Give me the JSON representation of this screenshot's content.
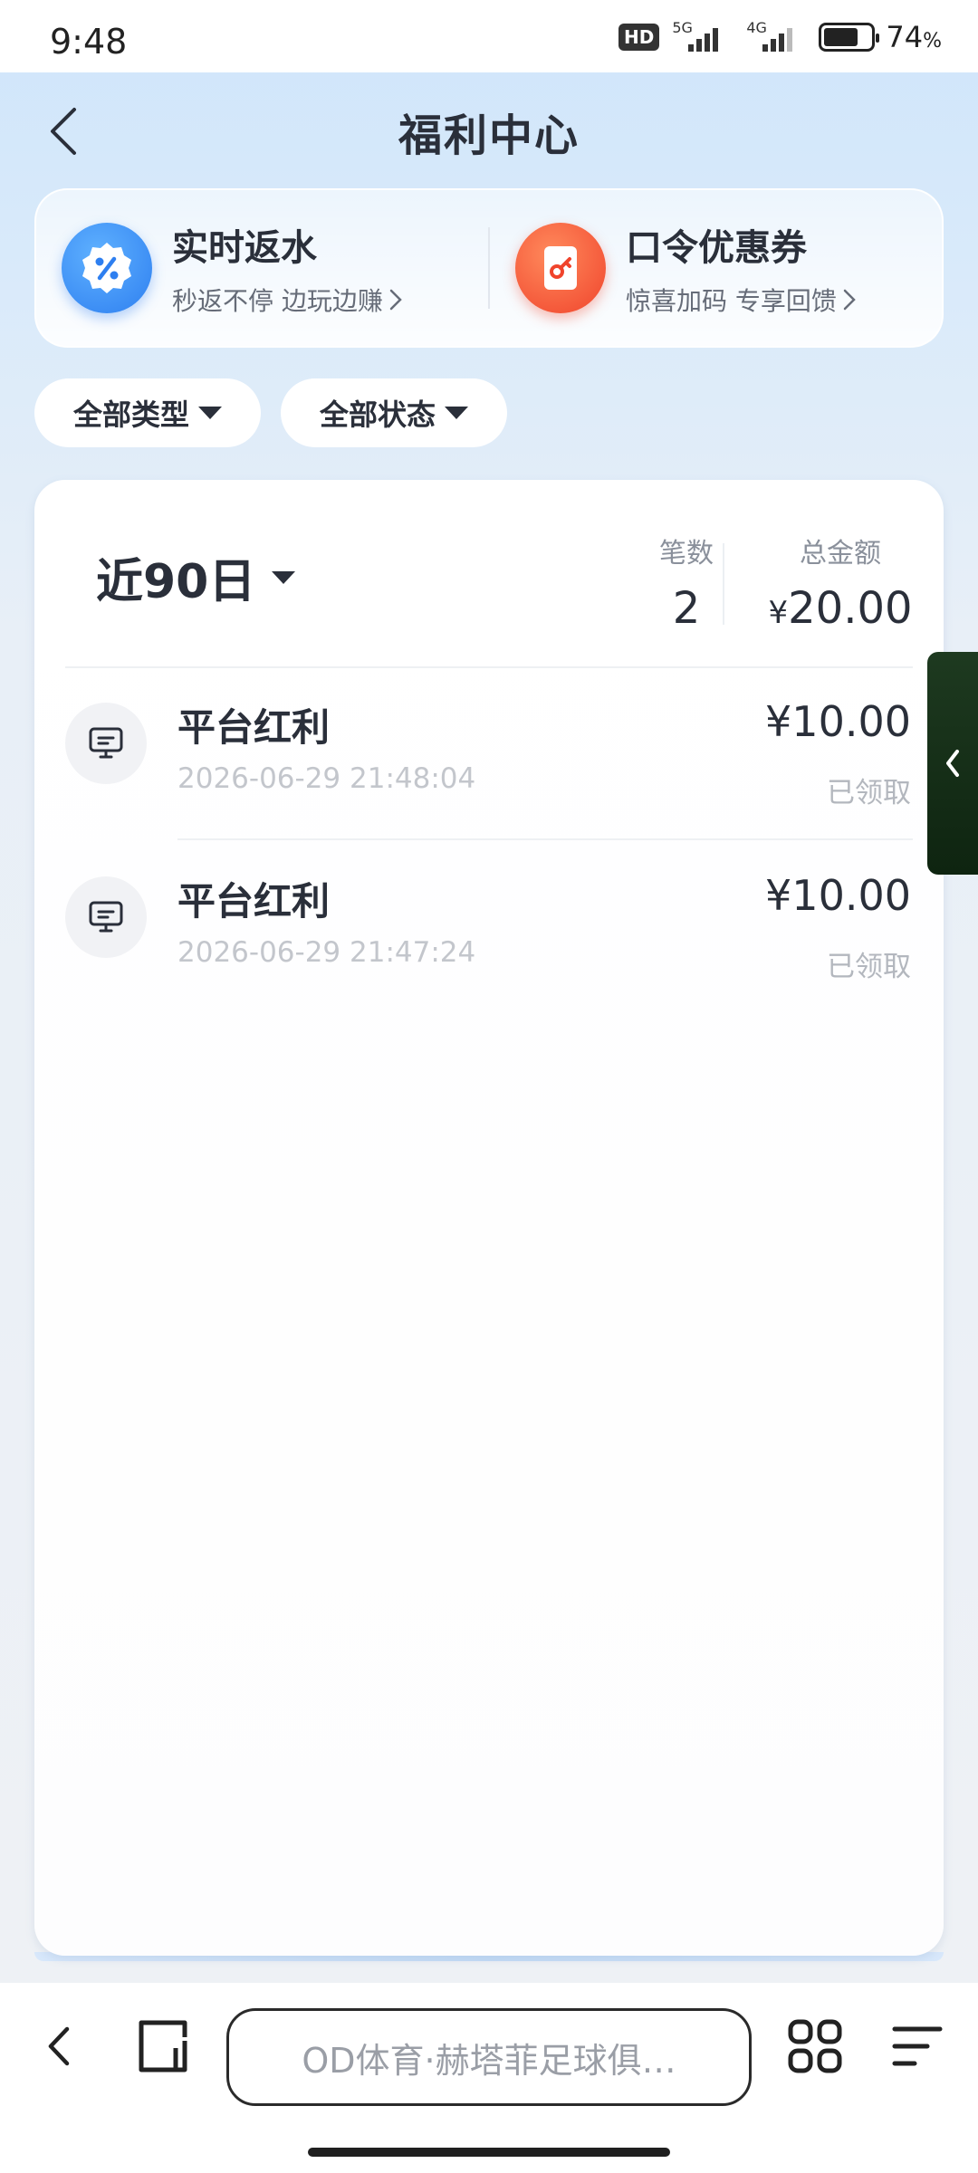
{
  "status_bar": {
    "time": "9:48",
    "hd_badge": "HD",
    "net1": "5G",
    "net2": "4G",
    "battery_percent": "74",
    "battery_unit": "%",
    "battery_level": 0.74
  },
  "header": {
    "title": "福利中心"
  },
  "promos": [
    {
      "title": "实时返水",
      "subtitle": "秒返不停 边玩边赚",
      "icon": "percent-badge-icon",
      "color": "#2e7ff0"
    },
    {
      "title": "口令优惠券",
      "subtitle": "惊喜加码 专享回馈",
      "icon": "key-ticket-icon",
      "color": "#f0442c"
    }
  ],
  "filters": {
    "type_label": "全部类型",
    "status_label": "全部状态"
  },
  "summary": {
    "period_label": "近90日",
    "count_label": "笔数",
    "count_value": "2",
    "total_label": "总金额",
    "total_currency": "¥",
    "total_value": "20.00"
  },
  "records": [
    {
      "title": "平台红利",
      "time": "2026-06-29 21:48:04",
      "amount": "¥10.00",
      "status": "已领取"
    },
    {
      "title": "平台红利",
      "time": "2026-06-29 21:47:24",
      "amount": "¥10.00",
      "status": "已领取"
    }
  ],
  "browser": {
    "url_text": "OD体育·赫塔菲足球俱…"
  }
}
